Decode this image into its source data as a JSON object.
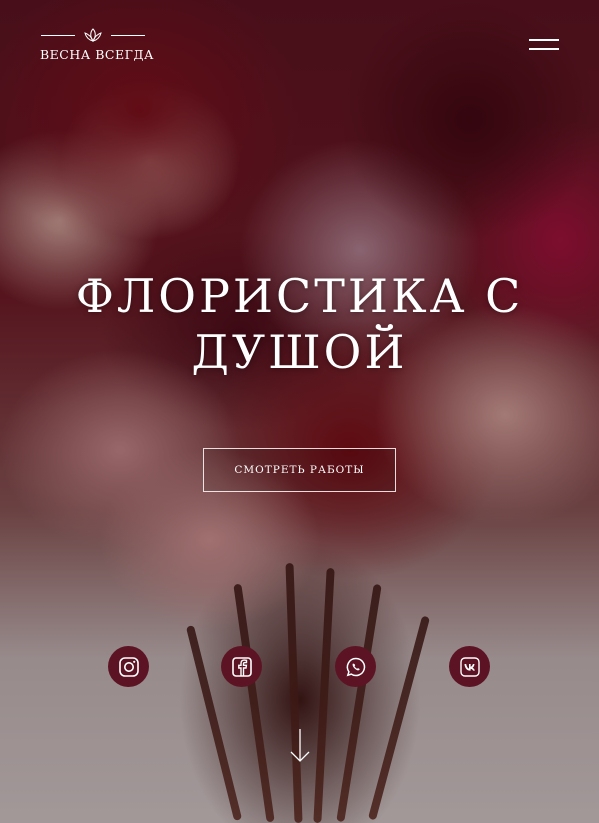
{
  "header": {
    "logo_text": "ВЕСНА ВСЕГДА",
    "logo_icon": "lotus-icon",
    "menu_icon": "hamburger-menu-icon"
  },
  "hero": {
    "title_line1": "ФЛОРИСТИКА С",
    "title_line2": "ДУШОЙ",
    "cta_label": "СМОТРЕТЬ РАБОТЫ"
  },
  "social": [
    {
      "name": "instagram",
      "icon": "instagram-icon"
    },
    {
      "name": "facebook",
      "icon": "facebook-icon"
    },
    {
      "name": "whatsapp",
      "icon": "whatsapp-icon"
    },
    {
      "name": "vk",
      "icon": "vk-icon"
    }
  ],
  "scroll": {
    "icon": "arrow-down-icon"
  },
  "colors": {
    "text": "#ffffff",
    "social_bg": "#5c1424"
  }
}
